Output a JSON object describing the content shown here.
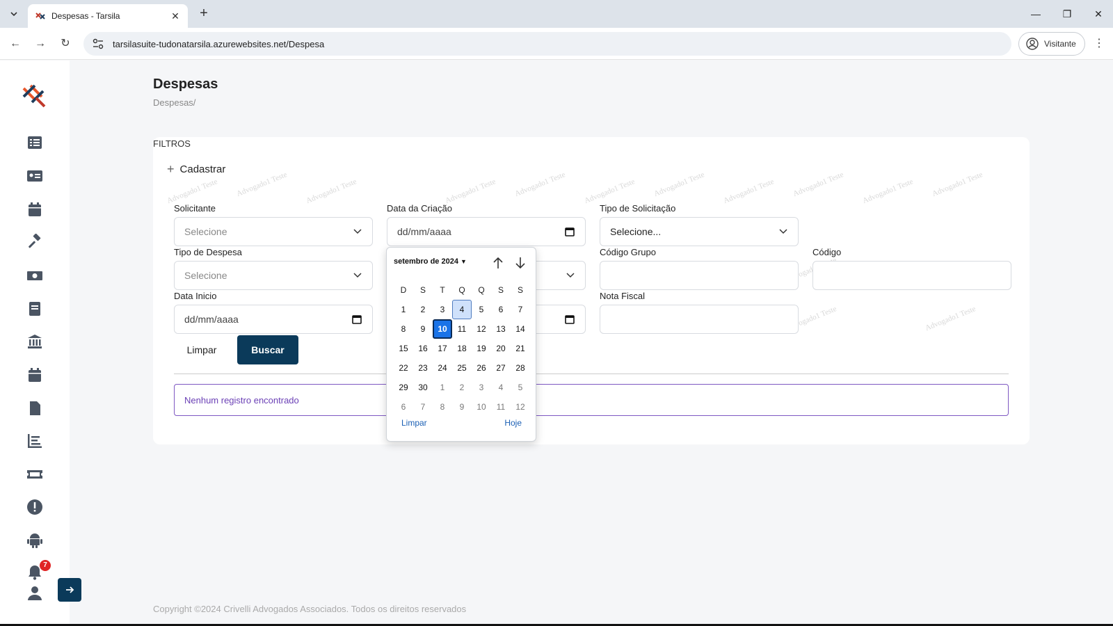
{
  "browser": {
    "tab_title": "Despesas - Tarsila",
    "url": "tarsilasuite-tudonatarsila.azurewebsites.net/Despesa",
    "profile_label": "Visitante"
  },
  "sidebar": {
    "items": [
      "list-icon",
      "id-card-icon",
      "calendar-icon",
      "gavel-icon",
      "money-icon",
      "book-icon",
      "bank-icon",
      "calendar-icon",
      "file-icon",
      "chart-icon",
      "ticket-icon",
      "alert-icon",
      "android-icon",
      "bell-icon",
      "user-icon"
    ],
    "notification_count": "7"
  },
  "page": {
    "title": "Despesas",
    "breadcrumb": "Despesas/",
    "filters_label": "FILTROS",
    "cadastrar": "Cadastrar"
  },
  "filters": {
    "solicitante": {
      "label": "Solicitante",
      "value": "Selecione"
    },
    "data_criacao": {
      "label": "Data da Criação",
      "value": "dd/mm/aaaa"
    },
    "tipo_solicitacao": {
      "label": "Tipo de Solicitação",
      "value": "Selecione..."
    },
    "tipo_despesa": {
      "label": "Tipo de Despesa",
      "value": "Selecione"
    },
    "codigo_grupo": {
      "label": "Código Grupo",
      "value": ""
    },
    "codigo": {
      "label": "Código",
      "value": ""
    },
    "data_inicio": {
      "label": "Data Inicio",
      "value": "dd/mm/aaaa"
    },
    "nota_fiscal": {
      "label": "Nota Fiscal",
      "value": ""
    }
  },
  "buttons": {
    "limpar": "Limpar",
    "buscar": "Buscar"
  },
  "result": {
    "empty_message": "Nenhum registro encontrado"
  },
  "watermark_text": "Advogado1 Teste",
  "datepicker": {
    "month_label": "setembro de 2024",
    "weekdays": [
      "D",
      "S",
      "T",
      "Q",
      "Q",
      "S",
      "S"
    ],
    "days": [
      [
        "1",
        "2",
        "3",
        "4",
        "5",
        "6",
        "7"
      ],
      [
        "8",
        "9",
        "10",
        "11",
        "12",
        "13",
        "14"
      ],
      [
        "15",
        "16",
        "17",
        "18",
        "19",
        "20",
        "21"
      ],
      [
        "22",
        "23",
        "24",
        "25",
        "26",
        "27",
        "28"
      ],
      [
        "29",
        "30",
        "1",
        "2",
        "3",
        "4",
        "5"
      ],
      [
        "6",
        "7",
        "8",
        "9",
        "10",
        "11",
        "12"
      ]
    ],
    "focused_day": "4",
    "today": "10",
    "clear_label": "Limpar",
    "today_label": "Hoje"
  },
  "footer": {
    "copyright": "Copyright ©2024 Crivelli Advogados Associados. Todos os direitos reservados"
  },
  "colors": {
    "primary": "#0b3a5a",
    "alert_border": "#7e57c2",
    "today": "#1a73e8"
  }
}
